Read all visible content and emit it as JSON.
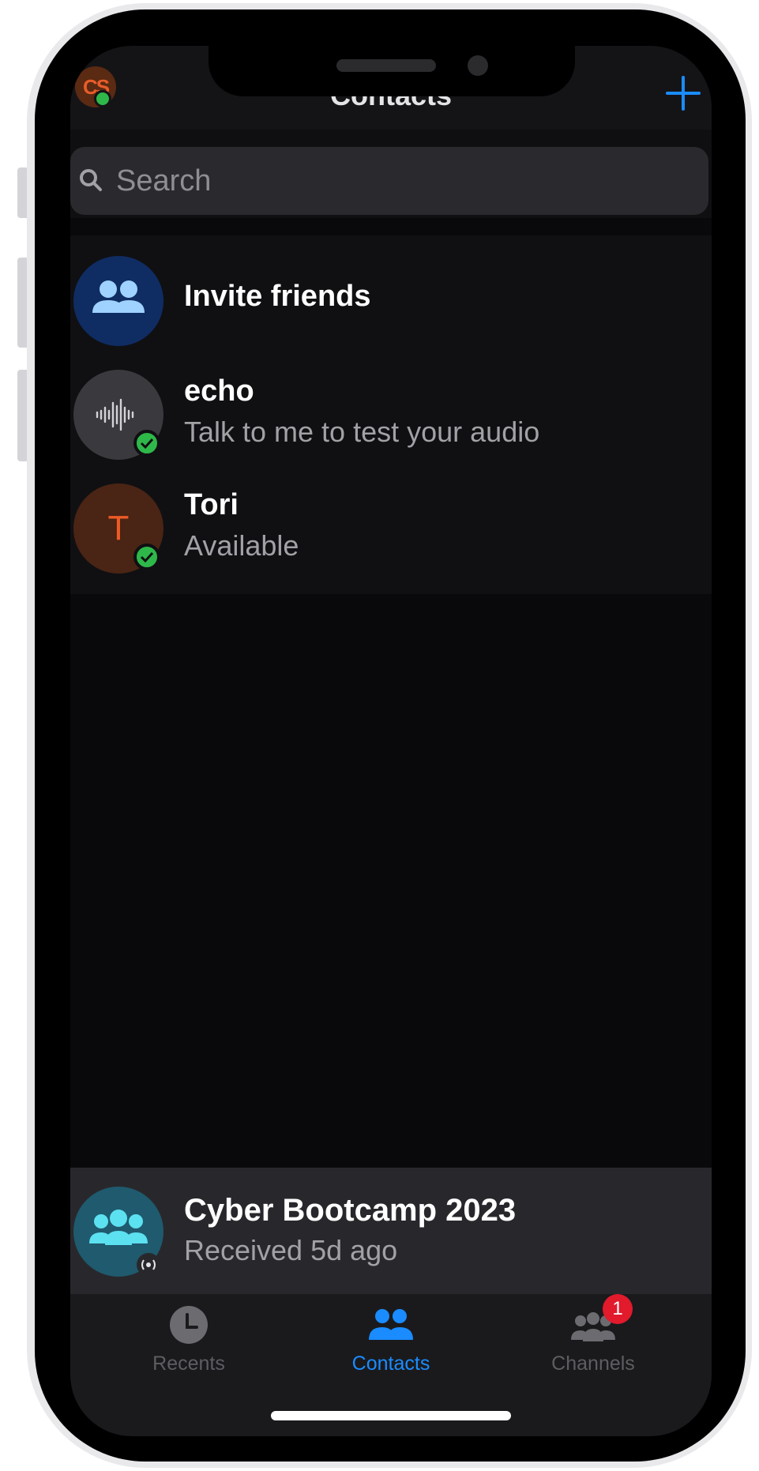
{
  "header": {
    "title": "Contacts",
    "avatar_initials": "CS",
    "add_icon": "plus-icon"
  },
  "search": {
    "placeholder": "Search",
    "value": ""
  },
  "contacts": [
    {
      "name": "Invite friends",
      "subtitle": "",
      "icon": "people-icon",
      "avatar_color": "#0f2d63"
    },
    {
      "name": "echo",
      "subtitle": "Talk to me to test your audio",
      "icon": "waveform-icon",
      "avatar_color": "#3a3a3e",
      "status": "online"
    },
    {
      "name": "Tori",
      "subtitle": "Available",
      "initial": "T",
      "avatar_color": "#4a2414",
      "status": "online"
    }
  ],
  "channel": {
    "name": "Cyber Bootcamp 2023",
    "subtitle": "Received 5d ago",
    "icon": "group-icon",
    "badge_icon": "broadcast-icon"
  },
  "tabs": [
    {
      "label": "Recents",
      "icon": "clock-icon",
      "active": false
    },
    {
      "label": "Contacts",
      "icon": "contacts-icon",
      "active": true
    },
    {
      "label": "Channels",
      "icon": "channels-icon",
      "active": false,
      "badge": "1"
    }
  ],
  "colors": {
    "accent": "#1a8cff",
    "online": "#2fb84a",
    "badge": "#e11a2c"
  }
}
